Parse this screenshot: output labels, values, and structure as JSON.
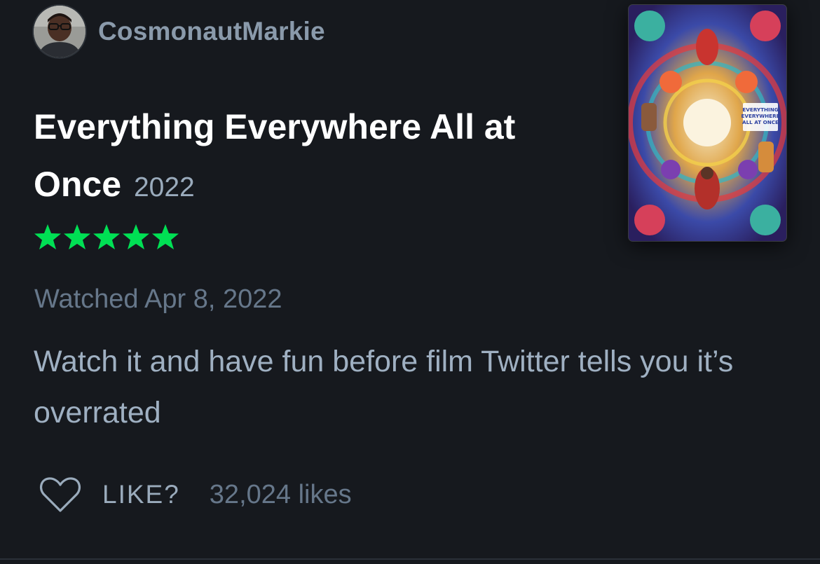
{
  "author": {
    "username": "CosmonautMarkie",
    "avatar_icon": "user-avatar-photo"
  },
  "film": {
    "title": "Everything Everywhere All at Once",
    "year": "2022",
    "poster_text": [
      "EVERYTHING",
      "EVERYWHERE",
      "ALL AT ONCE"
    ]
  },
  "rating": {
    "stars": 5,
    "max": 5,
    "color": "#00e054"
  },
  "watched": "Watched Apr 8, 2022",
  "review": {
    "text": "Watch it and have fun before film Twitter tells you it’s overrated"
  },
  "actions": {
    "like_label": "LIKE?",
    "likes_count": "32,024 likes",
    "heart_icon": "heart-outline-icon"
  },
  "colors": {
    "background": "#16191e",
    "username": "#8a9aab",
    "title": "#ffffff",
    "muted": "#66778a",
    "body": "#9fb0c2",
    "star": "#00e054"
  }
}
